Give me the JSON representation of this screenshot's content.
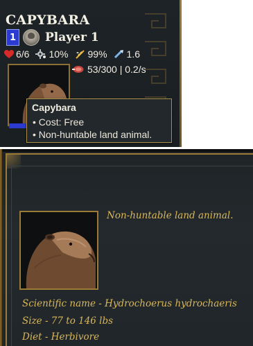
{
  "unit": {
    "title": "CAPYBARA",
    "player_number": "1",
    "player_name": "Player 1",
    "stats": {
      "health": "6/6",
      "stat2": "10%",
      "stat3": "99%",
      "stat4": "1.6"
    },
    "food": "53/300 | 0.2/s"
  },
  "tooltip": {
    "title": "Capybara",
    "cost": "• Cost: Free",
    "note": "• Non-huntable land animal."
  },
  "info": {
    "description": "Non-huntable land animal.",
    "scientific_name": "Scientific name - Hydrochoerus hydrochaeris",
    "size": "Size - 77 to 146 lbs",
    "diet": "Diet - Herbivore"
  },
  "colors": {
    "player_blue": "#2b3bd0",
    "gold_text": "#d9b75a",
    "gold_border": "#9b7b36",
    "panel_bg": "#1f2427"
  },
  "icons": [
    "heart-icon",
    "gear-icon",
    "wheat-icon",
    "speed-icon",
    "meat-icon",
    "player-avatar-icon"
  ]
}
